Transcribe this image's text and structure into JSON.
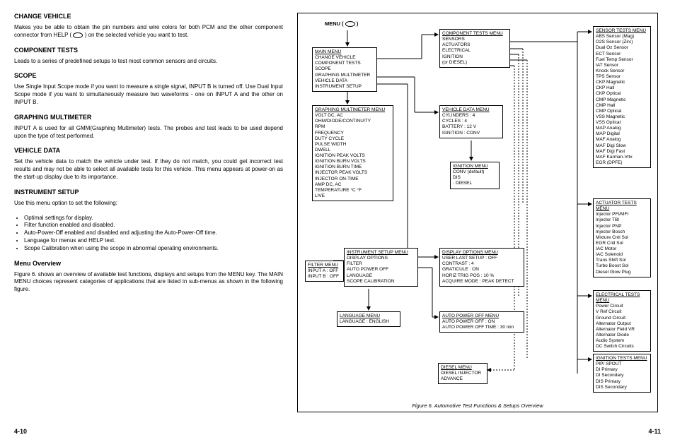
{
  "left": {
    "h_change_vehicle": "CHANGE VEHICLE",
    "p_change_vehicle_a": "Makes you be able to obtain the pin numbers and wire colors for both PCM and the other component connector from HELP ( ",
    "p_change_vehicle_b": " ) on the selected vehicle you want to test.",
    "h_component_tests": "COMPONENT TESTS",
    "p_component_tests": "Leads to a series of predefined setups to test most common sensors and circuits.",
    "h_scope": "SCOPE",
    "p_scope": "Use Single Input Scope mode if you want to measure a single signal, INPUT B is turned off. Use Dual Input Scope mode if you want to simultaneously measure two waveforms - one on INPUT A and the other on INPUT B.",
    "h_gmm": "GRAPHING MULTIMETER",
    "p_gmm": "INPUT A  is used for all GMM(Graphing Multimeter) tests. The probes and test leads to be used depend upon the type of test performed.",
    "h_vdata": "VEHICLE DATA",
    "p_vdata": "Set the vehicle data to match the vehicle under test. If they do not match, you could get incorrect test results and may not be able to select all available tests for this vehicle. This menu appears at power-on as the start-up display due to its importance.",
    "h_isetup": "INSTRUMENT SETUP",
    "p_isetup": "Use this menu option to set the following:",
    "b1": "Optimal settings for display.",
    "b2": "Filter function enabled and disabled.",
    "b3": "Auto-Power-Off enabled and disabled and adjusting the Auto-Power-Off time.",
    "b4": "Language for menus and HELP text.",
    "b5": "Scope Calibration when using the scope in abnormal operating environments.",
    "h_menuov": "Menu Overview",
    "p_menuov": "Figure 6. shows an overview of available test functions, displays and setups from the MENU key. The MAIN MENU choices represent categories of applications that are listed in sub-menus as shown in the following figure."
  },
  "menu_label_a": "MENU ( ",
  "menu_label_b": " )",
  "mainmenu": {
    "title": "MAIN MENU",
    "i1": "CHANGE VEHICLE",
    "i2": "COMPONENT TESTS",
    "i3": "SCOPE",
    "i4": "GRAPHING MULTIMETER",
    "i5": "VEHICLE DATA",
    "i6": "INSTRUMENT SETUP"
  },
  "compmenu": {
    "title": "COMPONENT TESTS MENU",
    "i1": "SENSORS",
    "i2": "ACTUATORS",
    "i3": "ELECTRICAL",
    "i4": "IGNITION",
    "i5": "(or DIESEL)"
  },
  "gmmmenu": {
    "title": "GRAPHING MULTIMETER MENU",
    "i1": "VOLT DC, AC",
    "i2": "OHM/DIODE/CONTINUITY",
    "i3": "RPM",
    "i4": "FREQUENCY",
    "i5": "DUTY CYCLE",
    "i6": "PULSE WIDTH",
    "i7": "DWELL",
    "i8": "IGNITION PEAK VOLTS",
    "i9": "IGNITION BURN VOLTS",
    "i10": "IGNITION BURN TIME",
    "i11": "INJECTOR PEAK VOLTS",
    "i12": "INJECTOR ON-TIME",
    "i13": "AMP DC, AC",
    "i14": "TEMPERATURE °C °F",
    "i15": "LIVE"
  },
  "vdatamenu": {
    "title": "VEHICLE DATA MENU",
    "i1": "CYLINDERS   : 4",
    "i2": "CYCLES         : 4",
    "i3": "BATTERY       : 12 V",
    "i4": "IGNITION       : CONV"
  },
  "ignmenu": {
    "title": "IGNITION MENU",
    "i1": "CONV (default)",
    "i2": "DIS",
    "i3": "· DIESEL"
  },
  "isetupmenu": {
    "title": "INSTRUMENT SETUP MENU",
    "i1": "DISPLAY OPTIONS",
    "i2": "FILTER",
    "i3": "AUTO POWER OFF",
    "i4": "LANGUAGE",
    "i5": "SCOPE CALIBRATION"
  },
  "filtermenu": {
    "title": "FILTER MENU",
    "i1": "INPUT A   : OFF",
    "i2": "INPUT B   : OFF"
  },
  "dispopt": {
    "title": "DISPLAY OPTIONS MENU",
    "i1": "USER LAST SETUP : OFF",
    "i2": "CONTRAST : 4",
    "i3": "GRATICULE : ON",
    "i4": "HORIZ TRIG  POS : 10 %",
    "i5": "ACQUIRE MODE : PEAK DETECT"
  },
  "langmenu": {
    "title": "LANGUAGE MENU",
    "i1": "LANGUAGE : ENGLISH"
  },
  "apomenu": {
    "title": "AUTO POWER OFF MENU",
    "i1": "AUTO POWER OFF : ON",
    "i2": "AUTO POWER OFF TIME : 30 min"
  },
  "dieselmenu": {
    "title": "DIESEL MENU",
    "i1": "DIESEL INJECTOR",
    "i2": "ADVANCE"
  },
  "sensormenu": {
    "title": "SENSOR TESTS MENU",
    "i1": "ABS Sensor (Mag)",
    "i2": "O2S Sensor (Zirc)",
    "i3": "Dual Oz Sensor",
    "i4": "ECT Sensor",
    "i5": "Fuel Temp Sensor",
    "i6": "IAT Sensor",
    "i7": "Knock Sensor",
    "i8": "TPS Sensor",
    "i9": "CKP Magnetic",
    "i10": "CKP Hall",
    "i11": "CKP Optical",
    "i12": "CMP Magnetic",
    "i13": "CMP Hall",
    "i14": "CMP Optical",
    "i15": "VSS Magnetic",
    "i16": "VSS Optical",
    "i17": "MAP Analog",
    "i18": "MAP Digital",
    "i19": "MAF Analog",
    "i20": "MAF Digi Slow",
    "i21": "MAF Digi Fast",
    "i22": "MAF Karman-Vrtx",
    "i23": "EGR (DPFE)"
  },
  "actmenu": {
    "title": "ACTUATOR TESTS MENU",
    "i1": "Injector PFI/MFI",
    "i2": "Injector TBI",
    "i3": "Injector PNP",
    "i4": "Injector Bosch",
    "i5": "Mixture Cntl Sol",
    "i6": "EGR Cntl Sol",
    "i7": "IAC Motor",
    "i8": "IAC Solenoid",
    "i9": "Trans Shift Sol",
    "i10": "Turbo Boost Sol",
    "i11": "Diesel Glow Plug"
  },
  "elecmenu": {
    "title": "ELECTRICAL TESTS MENU",
    "i1": "Power Circuit",
    "i2": "V Ref Circuit",
    "i3": "Ground Circuit",
    "i4": "Alternator Output",
    "i5": "Alternator Field VR",
    "i6": "Alternator Diode",
    "i7": "Audio System",
    "i8": "DC Switch Circuits"
  },
  "igntestmenu": {
    "title": "IGNITION TESTS MENU",
    "i1": "PIP/ SPOUT",
    "i2": "DI Primary",
    "i3": "DI Secondary",
    "i4": "DIS Primary",
    "i5": "DIS Secondary"
  },
  "figcap": "Figure 6. Automotive Test Functions & Setups Overview",
  "pagenum_l": "4-10",
  "pagenum_r": "4-11"
}
